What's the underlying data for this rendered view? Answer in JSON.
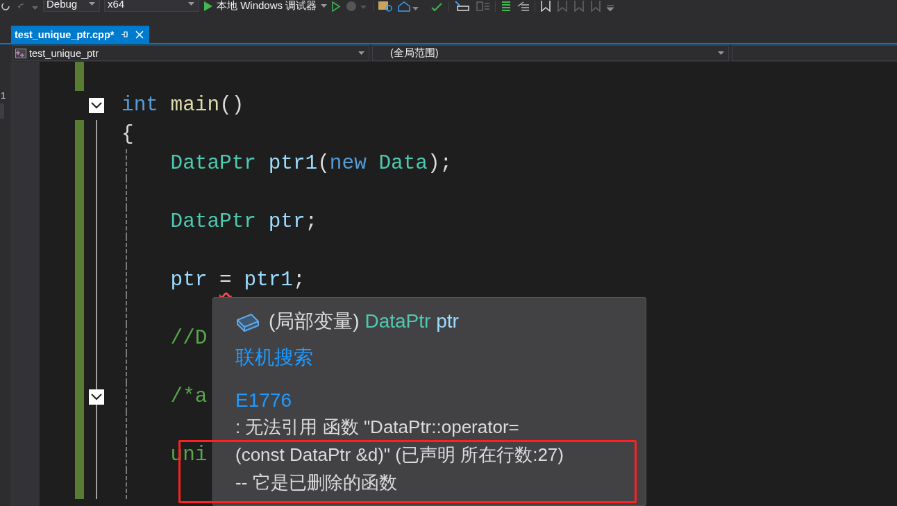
{
  "toolbar": {
    "configuration": "Debug",
    "platform": "x64",
    "run_label": "本地 Windows 调试器"
  },
  "side_panel": {
    "marker": "1"
  },
  "tabs": [
    {
      "label": "test_unique_ptr.cpp*",
      "selected": true
    }
  ],
  "nav": {
    "project": "test_unique_ptr",
    "scope": "(全局范围)"
  },
  "editor": {
    "lines": [
      {
        "kind": "blank",
        "changed": true
      },
      {
        "kind": "code",
        "changed": false,
        "collapsible": true,
        "tokens": [
          {
            "text": "int ",
            "kind": "keyword"
          },
          {
            "text": "main",
            "kind": "function"
          },
          {
            "text": "()",
            "kind": "plain"
          }
        ]
      },
      {
        "kind": "code",
        "changed": true,
        "collapsible": false,
        "tokens": [
          {
            "text": "{",
            "kind": "plain"
          }
        ],
        "children": [
          {
            "kind": "code",
            "changed": true,
            "collapsible": false,
            "tokens": [
              {
                "text": "DataPtr ",
                "kind": "type"
              },
              {
                "text": "ptr1",
                "kind": "variable"
              },
              {
                "text": "(",
                "kind": "plain"
              },
              {
                "text": "new ",
                "kind": "keyword"
              },
              {
                "text": "Data",
                "kind": "type"
              },
              {
                "text": ");",
                "kind": "plain"
              }
            ]
          },
          {
            "kind": "blank",
            "changed": true
          },
          {
            "kind": "code",
            "changed": true,
            "collapsible": false,
            "tokens": [
              {
                "text": "DataPtr ",
                "kind": "type"
              },
              {
                "text": "ptr",
                "kind": "variable"
              },
              {
                "text": ";",
                "kind": "plain"
              }
            ]
          },
          {
            "kind": "blank",
            "changed": true
          },
          {
            "kind": "code",
            "changed": true,
            "collapsible": false,
            "tokens": [
              {
                "text": "ptr ",
                "kind": "variable"
              },
              {
                "text": "=",
                "kind": "flagged"
              },
              {
                "text": " ptr1",
                "kind": "variable"
              },
              {
                "text": ";",
                "kind": "plain"
              }
            ]
          },
          {
            "kind": "blank",
            "changed": true
          },
          {
            "kind": "code",
            "changed": true,
            "collapsible": false,
            "tokens": [
              {
                "text": "//D",
                "kind": "comment"
              }
            ]
          },
          {
            "kind": "blank",
            "changed": true
          },
          {
            "kind": "code",
            "changed": true,
            "collapsible": true,
            "tokens": [
              {
                "text": "/*a",
                "kind": "comment"
              }
            ]
          },
          {
            "kind": "blank",
            "changed": true
          },
          {
            "kind": "code",
            "changed": true,
            "collapsible": false,
            "tokens": [
              {
                "text": "uni",
                "kind": "comment"
              }
            ]
          },
          {
            "kind": "blank",
            "changed": true
          }
        ]
      }
    ]
  },
  "quick_info": {
    "header": [
      {
        "text": "(局部变量) ",
        "kind": "plain"
      },
      {
        "text": "DataPtr",
        "kind": "type"
      },
      {
        "text": " ptr",
        "kind": "variable"
      }
    ],
    "search_link": "联机搜索",
    "error_code": "E1776",
    "message_lines": [
      ": 无法引用 函数 \"DataPtr::operator=",
      "(const DataPtr &d)\" (已声明 所在行数:27)",
      "-- 它是已删除的函数"
    ]
  }
}
